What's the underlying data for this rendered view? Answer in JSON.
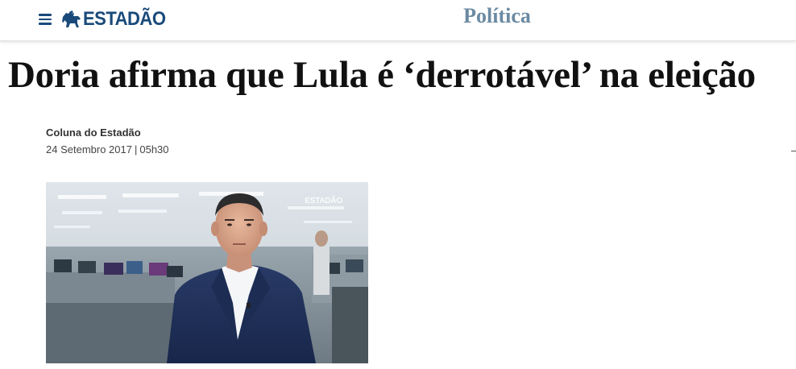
{
  "header": {
    "menu_icon": "hamburger-menu-icon",
    "logo_icon": "horse-rider-icon",
    "logo_text": "ESTADÃO",
    "section": "Política",
    "brand_color": "#1a4a7a",
    "section_color": "#6b8aa3"
  },
  "article": {
    "headline": "Doria afirma que Lula é ‘derrotável’ na eleição",
    "author": "Coluna do Estadão",
    "date": "24 Setembro 2017",
    "time": "05h30"
  },
  "photo": {
    "watermark": "ESTADÃO"
  }
}
